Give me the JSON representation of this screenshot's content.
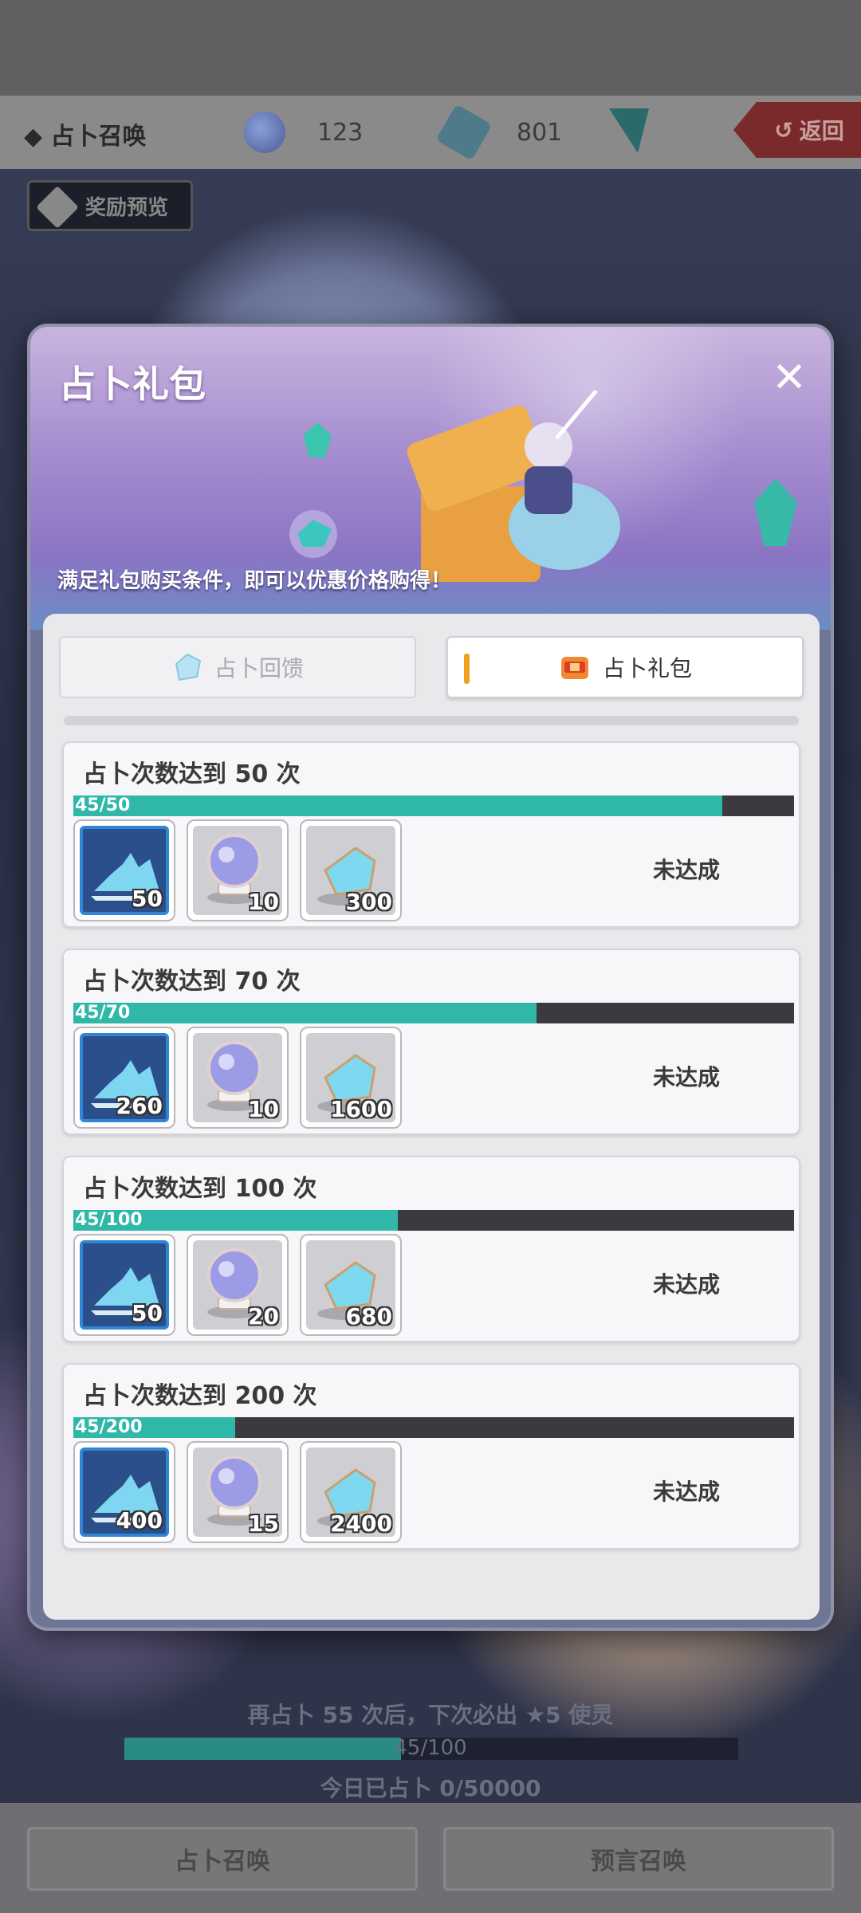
{
  "top": {
    "title": "◆ 占卜召唤",
    "orb_count": "123",
    "gem_count": "801",
    "back_label": "返回",
    "preview_label": "奖励预览"
  },
  "modal": {
    "title": "占卜礼包",
    "subtitle": "满足礼包购买条件，即可以优惠价格购得！",
    "tabs": [
      {
        "label": "占卜回馈",
        "active": false
      },
      {
        "label": "占卜礼包",
        "active": true
      }
    ],
    "rewards": [
      {
        "title": "占卜次数达到 50 次",
        "progress_text": "45/50",
        "progress": 0.9,
        "items": [
          {
            "icon": "blue-crystal-pile-icon",
            "count": "50"
          },
          {
            "icon": "crystal-ball-icon",
            "count": "10"
          },
          {
            "icon": "gem-icon",
            "count": "300"
          }
        ],
        "status": "未达成"
      },
      {
        "title": "占卜次数达到 70 次",
        "progress_text": "45/70",
        "progress": 0.643,
        "items": [
          {
            "icon": "blue-crystal-pile-icon",
            "count": "260"
          },
          {
            "icon": "crystal-ball-icon",
            "count": "10"
          },
          {
            "icon": "gem-icon",
            "count": "1600"
          }
        ],
        "status": "未达成"
      },
      {
        "title": "占卜次数达到 100 次",
        "progress_text": "45/100",
        "progress": 0.45,
        "items": [
          {
            "icon": "blue-crystal-pile-icon",
            "count": "50"
          },
          {
            "icon": "crystal-ball-icon",
            "count": "20"
          },
          {
            "icon": "gem-icon",
            "count": "680"
          }
        ],
        "status": "未达成"
      },
      {
        "title": "占卜次数达到 200 次",
        "progress_text": "45/200",
        "progress": 0.225,
        "items": [
          {
            "icon": "blue-crystal-pile-icon",
            "count": "400"
          },
          {
            "icon": "crystal-ball-icon",
            "count": "15"
          },
          {
            "icon": "gem-icon",
            "count": "2400"
          }
        ],
        "status": "未达成"
      }
    ]
  },
  "bottom": {
    "pity_text": "再占卜 55 次后，下次必出 ★5 使灵",
    "progress_text": "45/100",
    "progress": 0.45,
    "today_text": "今日已占卜 0/50000",
    "nav": [
      "占卜召唤",
      "预言召唤"
    ]
  },
  "colors": {
    "progress_fill": "#2fb8a8",
    "progress_track": "#3b3b3f",
    "tab_accent": "#f0a020"
  }
}
